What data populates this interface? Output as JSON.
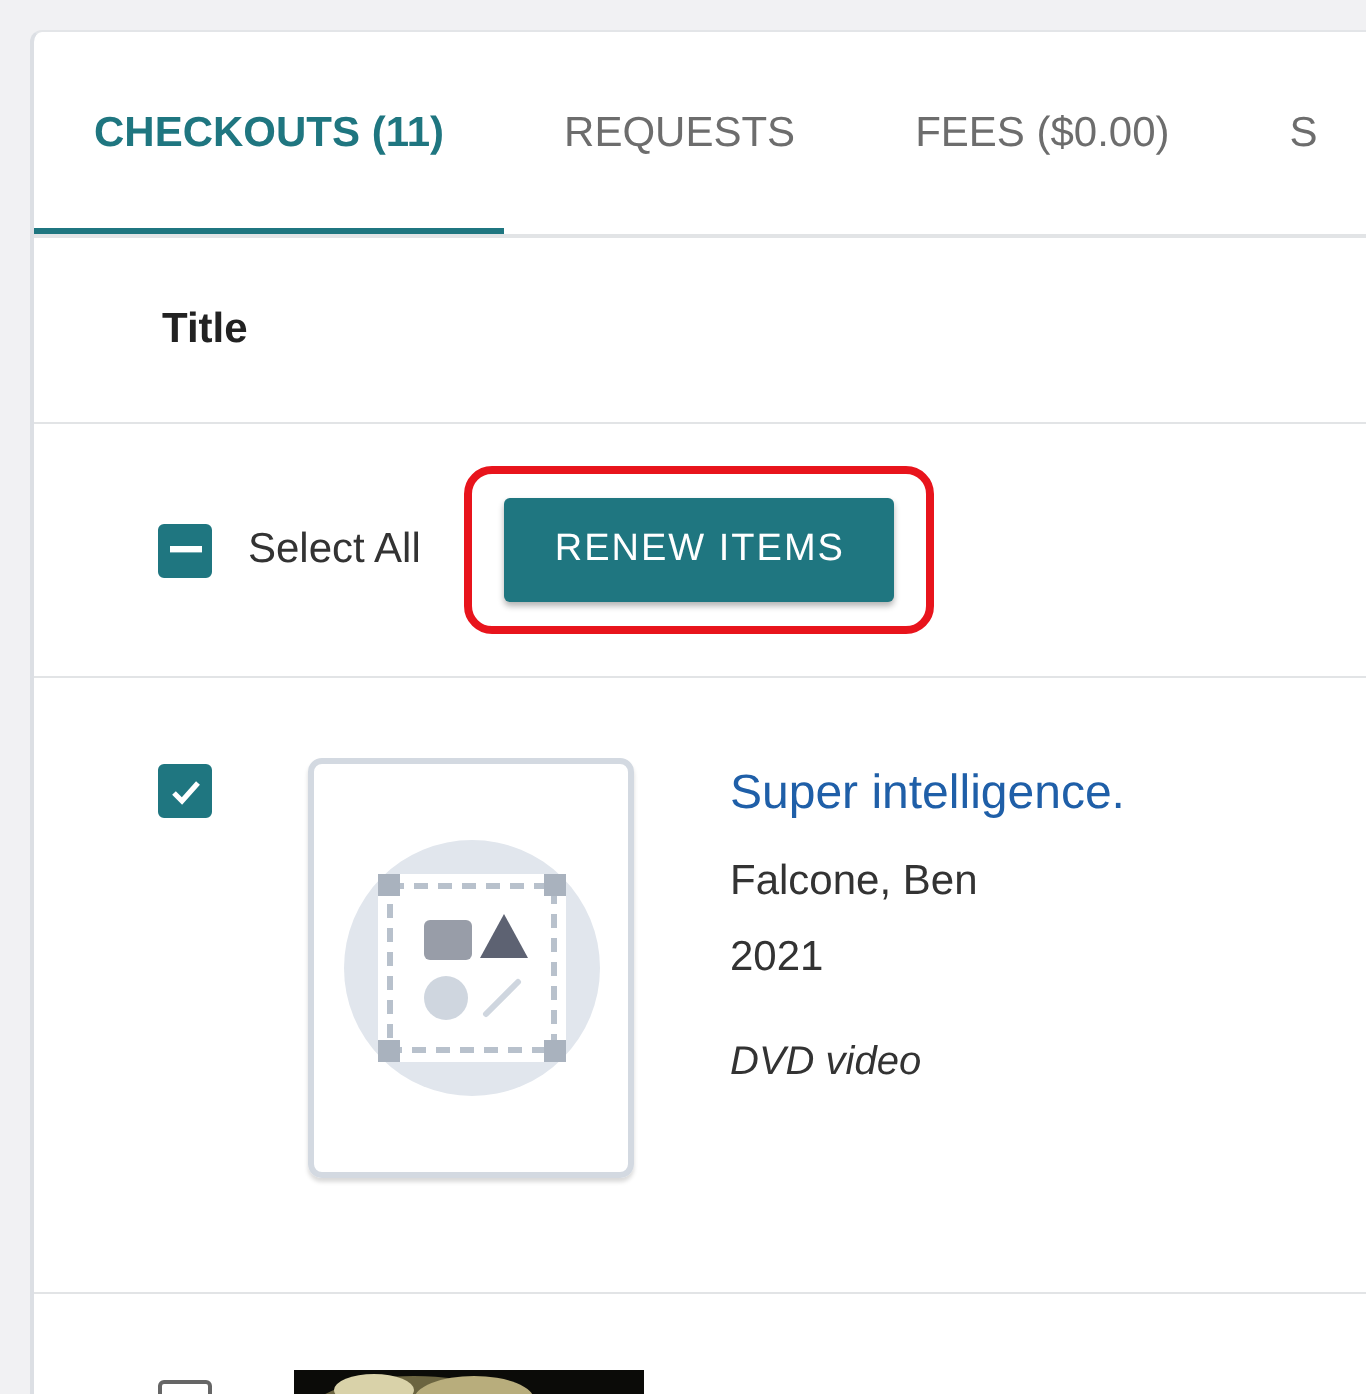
{
  "tabs": [
    {
      "label": "CHECKOUTS (11)",
      "selected": true
    },
    {
      "label": "REQUESTS",
      "selected": false
    },
    {
      "label": "FEES ($0.00)",
      "selected": false
    },
    {
      "label": "S",
      "selected": false
    }
  ],
  "table": {
    "column_header": "Title"
  },
  "select_all": {
    "label": "Select All",
    "checked": true,
    "indeterminate": true
  },
  "renew_button": {
    "label": "RENEW ITEMS",
    "highlighted": true
  },
  "items": [
    {
      "checked": true,
      "title": "Super intelligence.",
      "author": "Falcone, Ben",
      "year": "2021",
      "format": "DVD video",
      "cover": {
        "kind": "placeholder"
      }
    },
    {
      "checked": false
    }
  ]
}
